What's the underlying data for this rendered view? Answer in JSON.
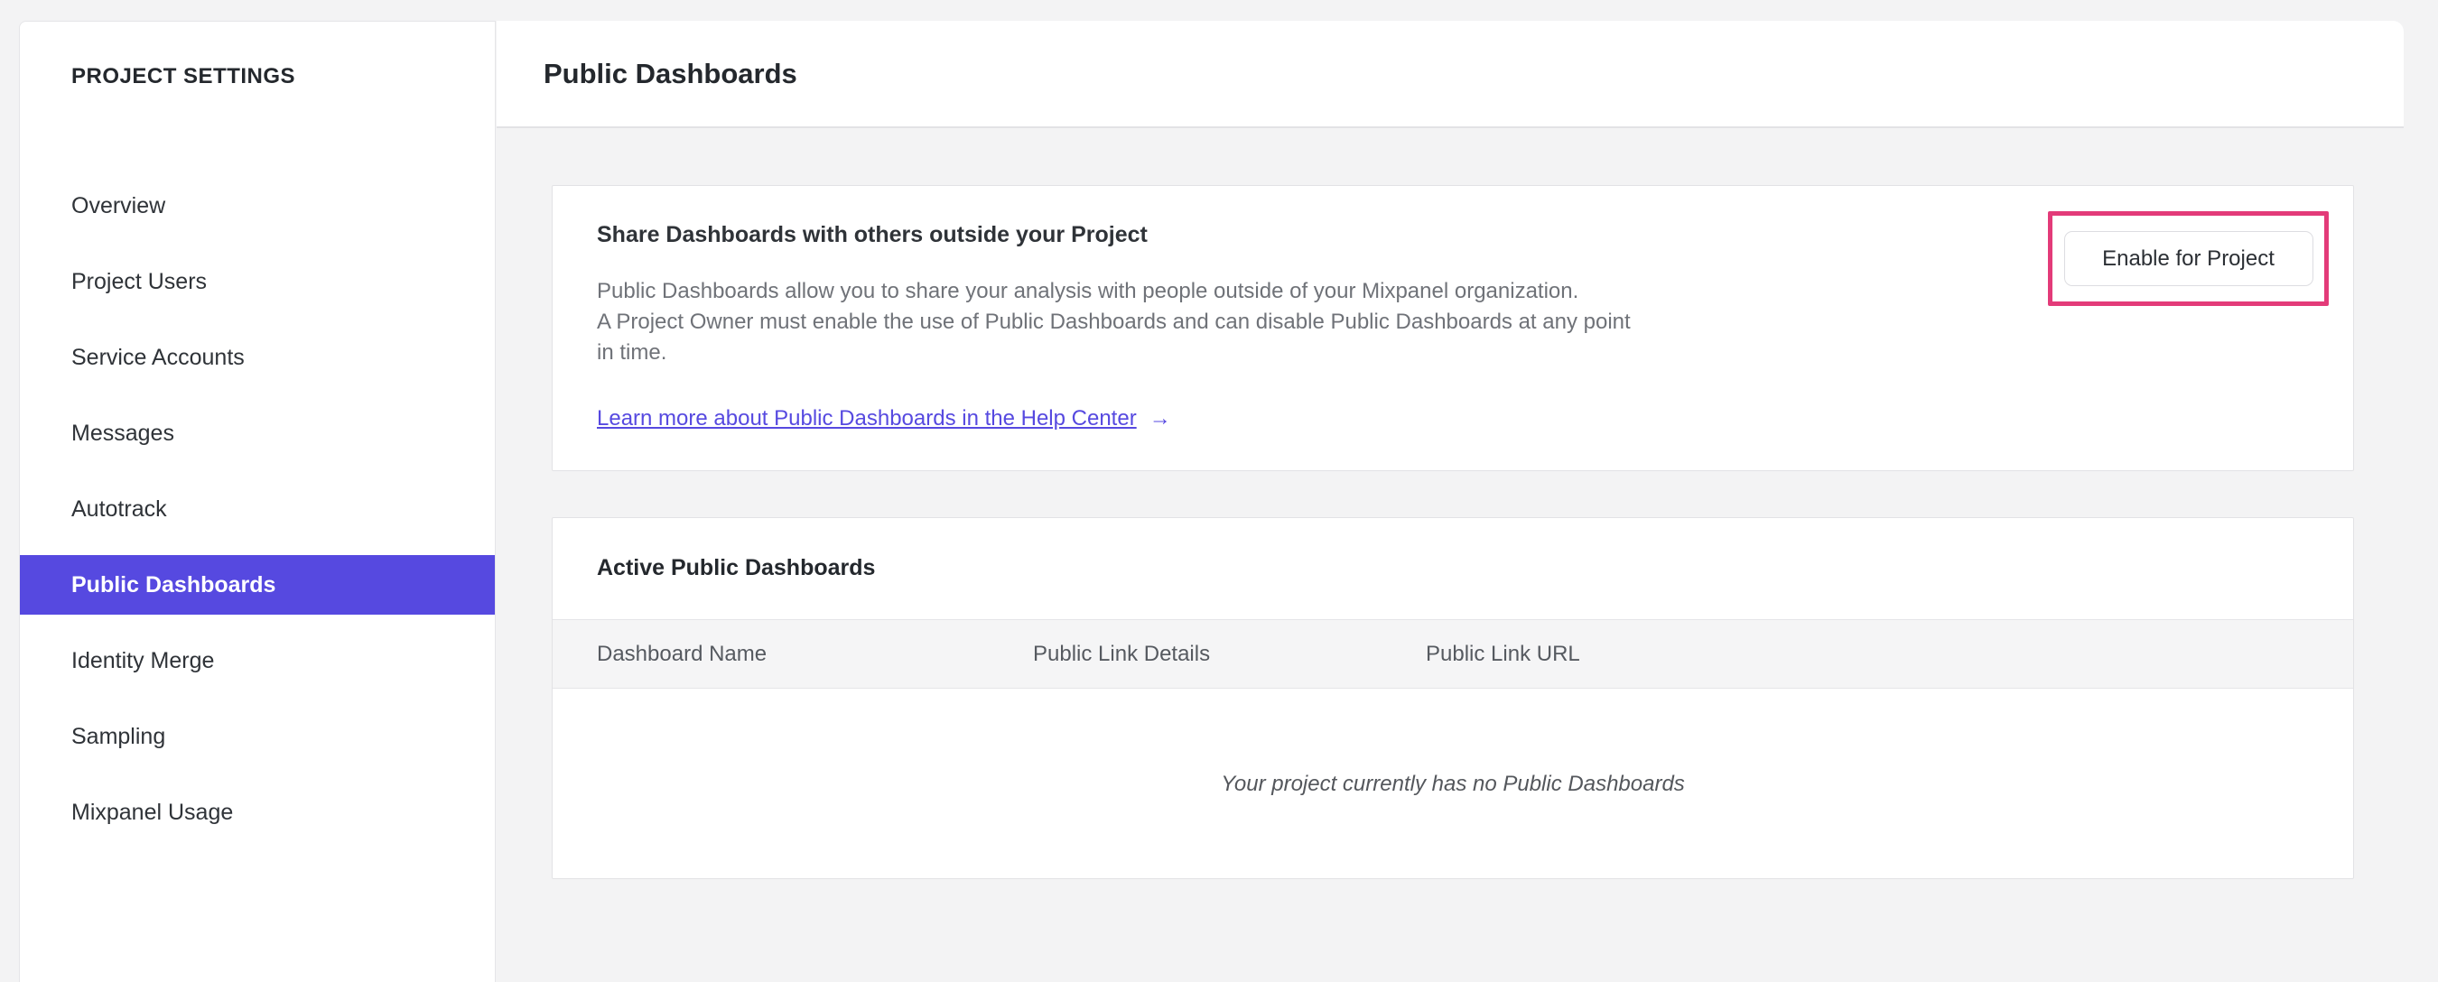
{
  "sidebar": {
    "header": "PROJECT SETTINGS",
    "items": [
      {
        "label": "Overview",
        "selected": false
      },
      {
        "label": "Project Users",
        "selected": false
      },
      {
        "label": "Service Accounts",
        "selected": false
      },
      {
        "label": "Messages",
        "selected": false
      },
      {
        "label": "Autotrack",
        "selected": false
      },
      {
        "label": "Public Dashboards",
        "selected": true
      },
      {
        "label": "Identity Merge",
        "selected": false
      },
      {
        "label": "Sampling",
        "selected": false
      },
      {
        "label": "Mixpanel Usage",
        "selected": false
      }
    ]
  },
  "header": {
    "title": "Public Dashboards"
  },
  "share_card": {
    "heading": "Share Dashboards with others outside your Project",
    "body_lines": [
      "Public Dashboards allow you to share your analysis with people outside of your Mixpanel organization.",
      "A Project Owner must enable the use of Public Dashboards and can disable Public Dashboards at any point",
      "in time."
    ],
    "link_label": "Learn more about Public Dashboards in the Help Center",
    "link_arrow": "→",
    "button_label": "Enable for Project"
  },
  "active_card": {
    "heading": "Active Public Dashboards",
    "columns": [
      "Dashboard Name",
      "Public Link Details",
      "Public Link URL"
    ],
    "empty_message": "Your project currently has no Public Dashboards"
  },
  "colors": {
    "accent_purple": "#5649e0",
    "link_purple": "#5649e0",
    "annotation_pink": "#e33b79",
    "page_background": "#f3f3f4",
    "card_border": "#e2e2e5"
  }
}
